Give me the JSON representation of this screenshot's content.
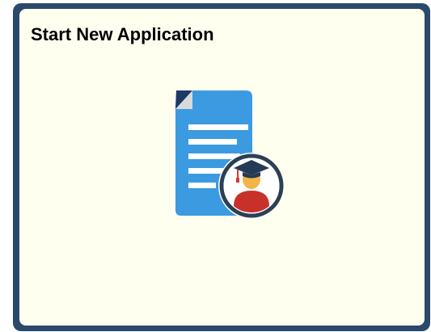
{
  "tile": {
    "title": "Start New Application",
    "icon": "document-graduate-icon"
  },
  "colors": {
    "tile_border": "#2b4a6b",
    "tile_background": "#fffff0",
    "document_blue": "#3c9ae0",
    "document_fold_navy": "#1e3a64",
    "avatar_ring": "#2b3f57",
    "cap": "#243a56",
    "tassel": "#d63a2e",
    "skin": "#f2b548",
    "body_red": "#c8312a"
  }
}
